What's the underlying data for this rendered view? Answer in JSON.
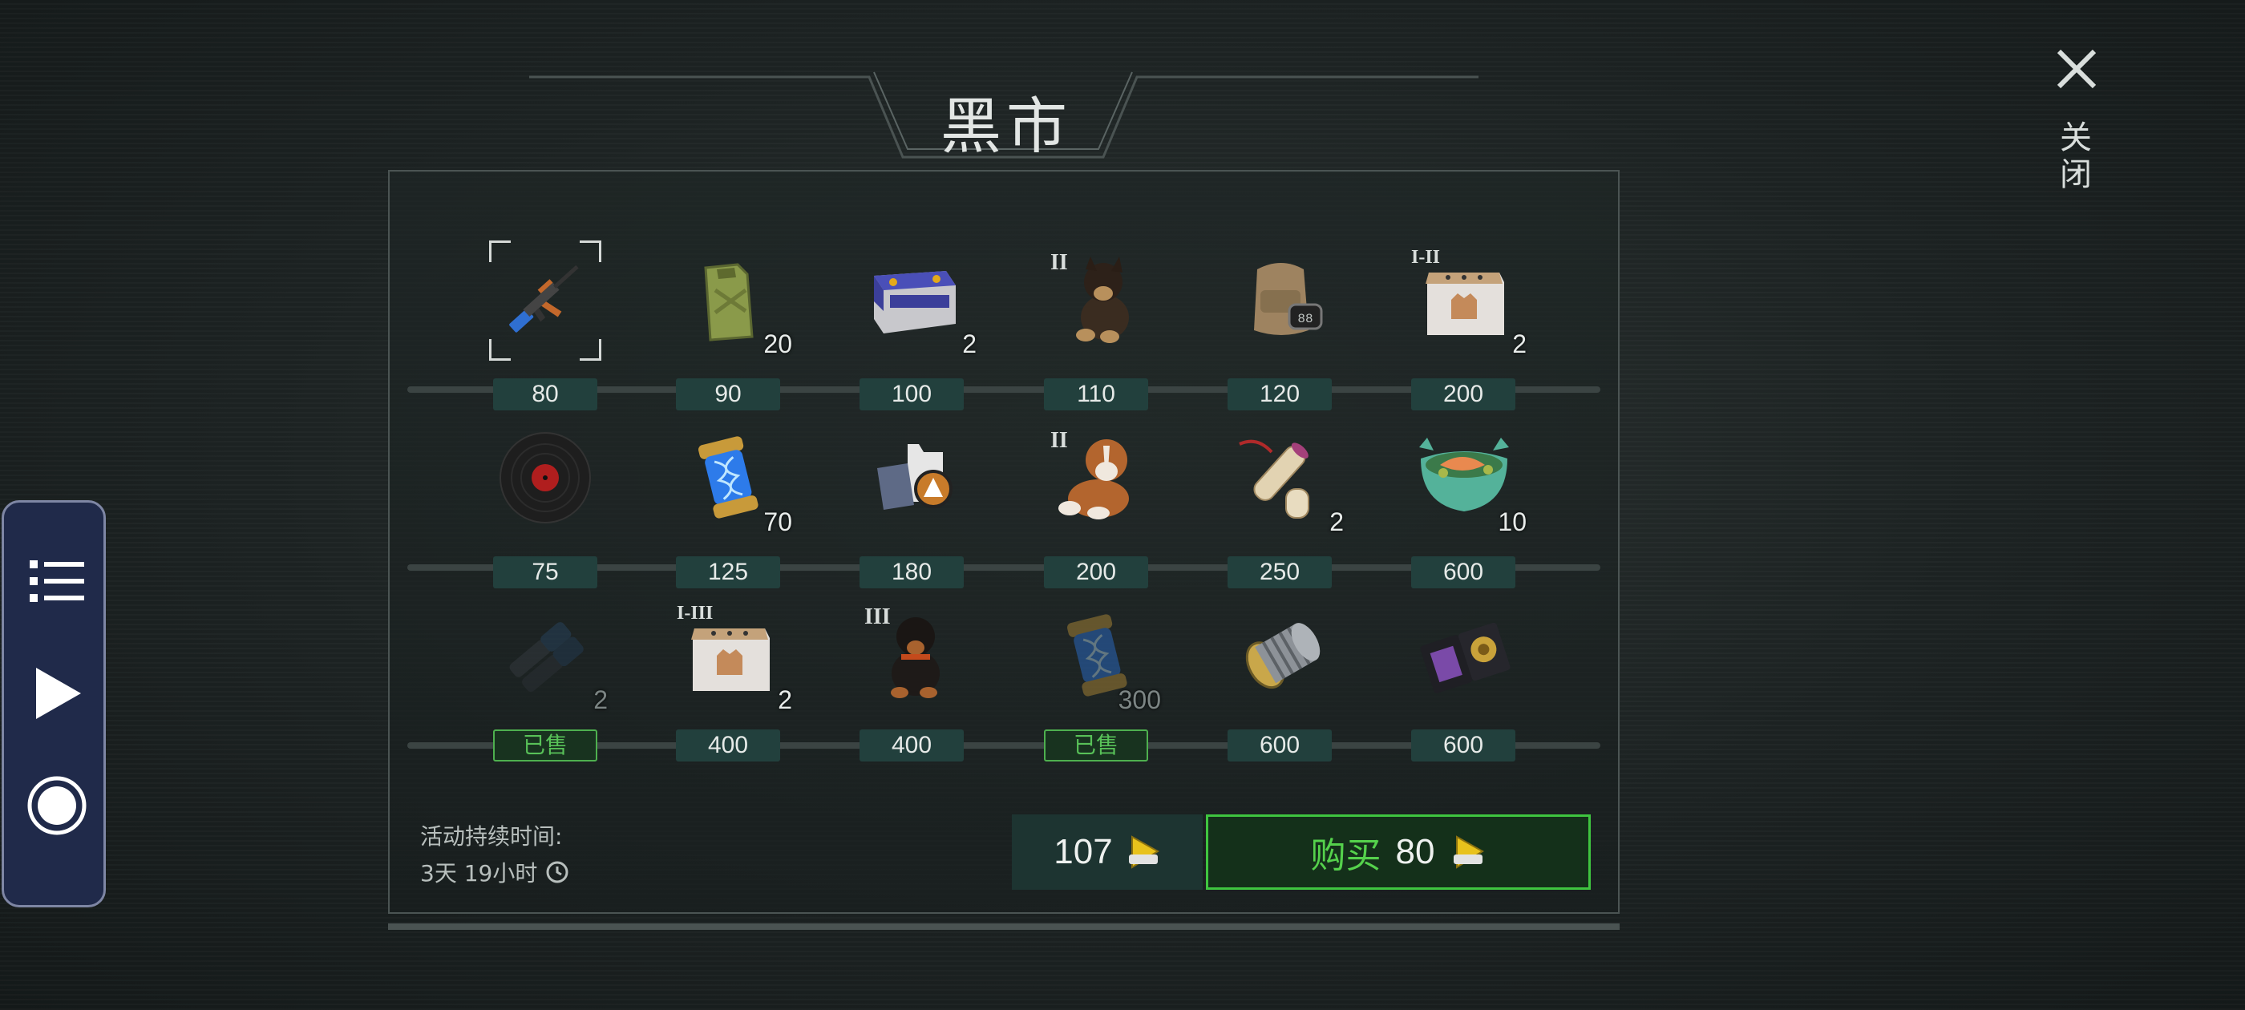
{
  "title": "黑市",
  "close": {
    "label": "关闭",
    "icon": "close-icon"
  },
  "rows": [
    [
      {
        "name": "ak-rifle",
        "price": "80",
        "selected": true
      },
      {
        "name": "fuel-jerrycan",
        "count": "20",
        "price": "90"
      },
      {
        "name": "car-battery",
        "count": "2",
        "price": "100"
      },
      {
        "name": "dog-shepherd-puppy",
        "tier": "II",
        "price": "110"
      },
      {
        "name": "backpack",
        "price": "120"
      },
      {
        "name": "mystery-box",
        "tier": "I-II",
        "count": "2",
        "price": "200"
      }
    ],
    [
      {
        "name": "vinyl-record",
        "price": "75"
      },
      {
        "name": "dna-capsule",
        "count": "70",
        "price": "125"
      },
      {
        "name": "outfit-set",
        "price": "180"
      },
      {
        "name": "dog-stbernard-puppy",
        "tier": "II",
        "price": "200"
      },
      {
        "name": "blueprint-scrolls",
        "count": "2",
        "price": "250"
      },
      {
        "name": "salmon-bowl",
        "count": "10",
        "price": "600"
      }
    ],
    [
      {
        "name": "binoculars",
        "count": "2",
        "price": "已售",
        "sold": true
      },
      {
        "name": "mystery-box",
        "tier": "I-III",
        "count": "2",
        "price": "400"
      },
      {
        "name": "dog-rottweiler-puppy",
        "tier": "III",
        "price": "400"
      },
      {
        "name": "dna-capsule",
        "count": "300",
        "price": "已售",
        "sold": true
      },
      {
        "name": "engine-part",
        "price": "600"
      },
      {
        "name": "police-badge-wallet",
        "price": "600"
      }
    ]
  ],
  "duration": {
    "label": "活动持续时间:",
    "value": "3天 19小时"
  },
  "balance": {
    "amount": "107",
    "currency_icon": "genesis-coin-icon"
  },
  "buy": {
    "label": "购买",
    "price": "80"
  },
  "side_dock": {
    "items": [
      "list-icon",
      "play-icon",
      "record-icon"
    ]
  },
  "colors": {
    "accent_green": "#3fc540",
    "sold_green": "#4eb04f",
    "price_bg": "#22403d"
  }
}
